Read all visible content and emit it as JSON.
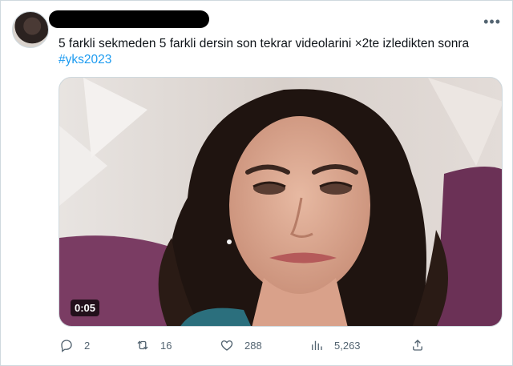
{
  "post": {
    "text": "5 farkli sekmeden 5 farkli dersin son tekrar videolarini ×2te izledikten sonra",
    "hashtag": "#yks2023",
    "more_icon": "more-horizontal-icon"
  },
  "media": {
    "duration": "0:05"
  },
  "actions": {
    "replies": "2",
    "reposts": "16",
    "likes": "288",
    "views": "5,263"
  },
  "colors": {
    "link": "#1d9bf0",
    "muted": "#536471",
    "border": "#cfd9de"
  }
}
